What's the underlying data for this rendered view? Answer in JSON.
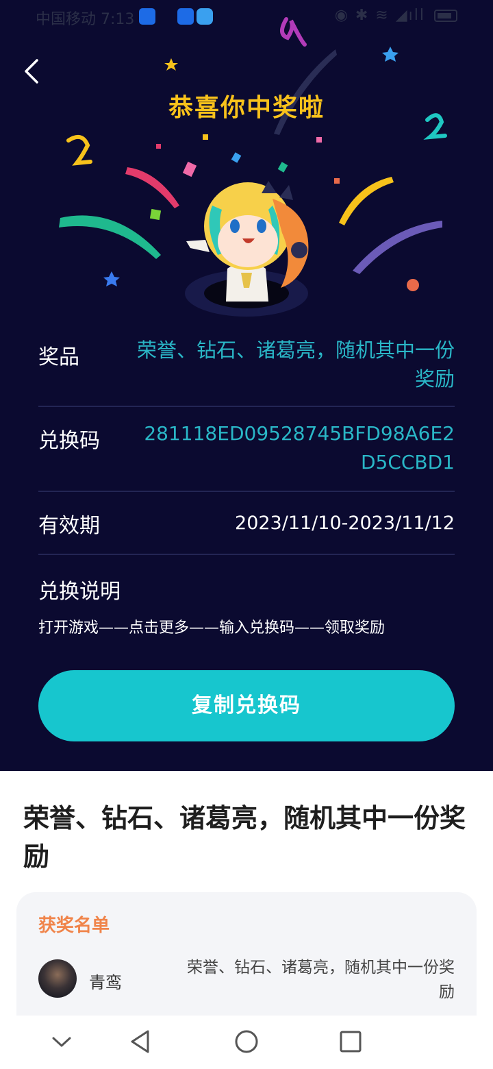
{
  "status_bar": {
    "carrier_time": "中国移动 7:13",
    "right_icons": "◉ ✱ ≋ ◢ıll"
  },
  "header": {
    "congrats_title": "恭喜你中奖啦"
  },
  "info": {
    "prize_label": "奖品",
    "prize_value": "荣誉、钻石、诸葛亮，随机其中一份奖励",
    "code_label": "兑换码",
    "code_value": "281118ED09528745BFD98A6E2D5CCBD1",
    "valid_label": "有效期",
    "valid_value": "2023/11/10-2023/11/12",
    "howto_label": "兑换说明",
    "howto_desc": "打开游戏——点击更多——输入兑换码——领取奖励"
  },
  "copy_button": "复制兑换码",
  "bottom": {
    "title": "荣誉、钻石、诸葛亮，随机其中一份奖励",
    "winners_title": "获奖名单",
    "winners": [
      {
        "name": "青鸾",
        "prize": "荣誉、钻石、诸葛亮，随机其中一份奖励"
      }
    ]
  },
  "colors": {
    "background_dark": "#0b0a30",
    "title_yellow": "#f9c21b",
    "accent_teal": "#17c6ce",
    "winners_orange": "#f0844a"
  },
  "icons": [
    "back-icon",
    "nav-back-icon",
    "nav-home-icon",
    "nav-recents-icon",
    "nav-hide-icon"
  ]
}
